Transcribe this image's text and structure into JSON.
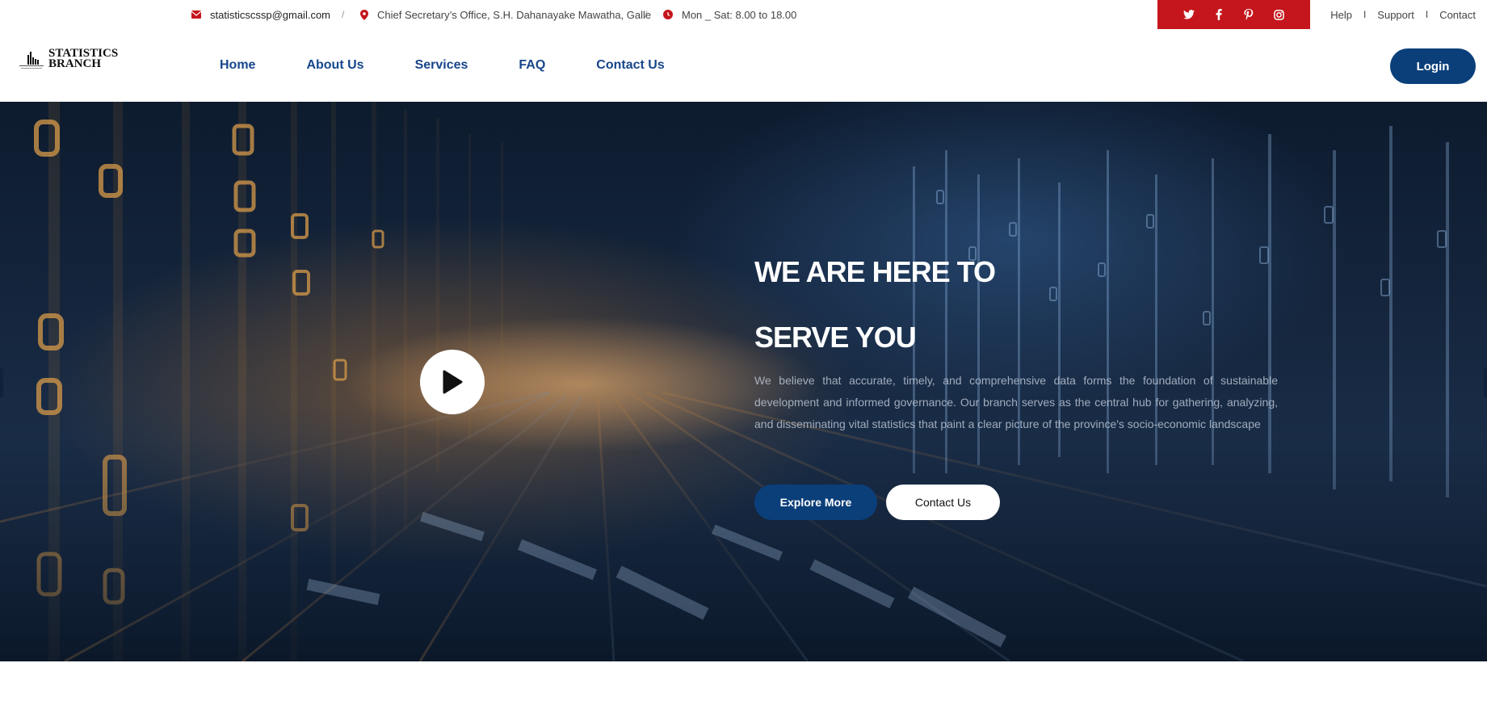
{
  "topbar": {
    "email": "statisticscssp@gmail.com",
    "address": "Chief Secretary’s Office, S.H. Dahanayake Mawatha, Galle",
    "hours": "Mon _ Sat: 8.00 to 18.00",
    "separator": "/",
    "links": [
      "Help",
      "Support",
      "Contact"
    ],
    "link_separator": "I",
    "social": [
      "twitter-icon",
      "facebook-icon",
      "pinterest-icon",
      "instagram-icon"
    ],
    "social_bg": "#c4161c"
  },
  "header": {
    "logo_line1": "STATISTICS",
    "logo_line2": "BRANCH",
    "nav": [
      "Home",
      "About Us",
      "Services",
      "FAQ",
      "Contact Us"
    ],
    "login_label": "Login",
    "accent": "#0b3f7a",
    "nav_color": "#17468b"
  },
  "hero": {
    "title_line1": "WE ARE HERE TO",
    "title_line2": "SERVE YOU",
    "paragraph": "We believe that accurate, timely, and comprehensive data forms the foundation of sustainable development and informed governance. Our branch serves as the central hub for gathering, analyzing, and disseminating vital statistics that paint a clear picture of the province's socio-economic landscape",
    "explore_label": "Explore More",
    "contact_label": "Contact Us",
    "play_icon": "play-icon"
  }
}
